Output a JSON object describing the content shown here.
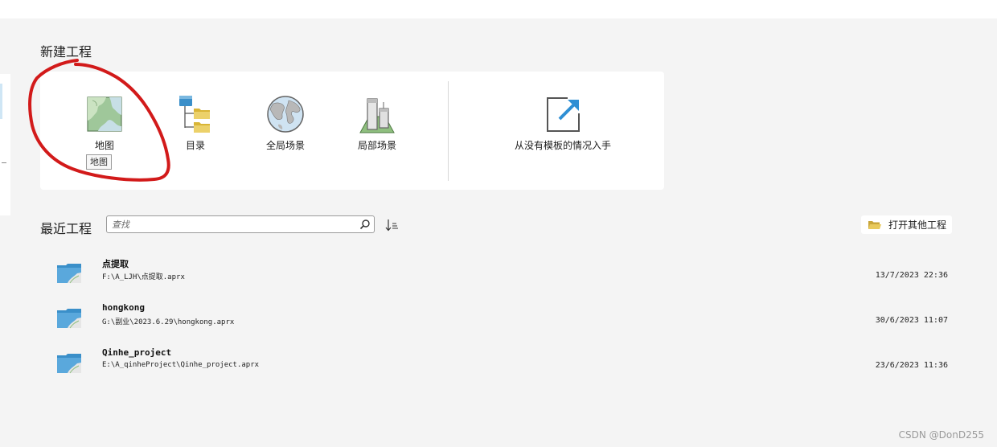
{
  "new_project": {
    "title": "新建工程",
    "templates": [
      {
        "label": "地图",
        "icon": "map-icon"
      },
      {
        "label": "目录",
        "icon": "catalog-icon"
      },
      {
        "label": "全局场景",
        "icon": "globe-icon"
      },
      {
        "label": "局部场景",
        "icon": "local-scene-icon"
      },
      {
        "label": "从没有模板的情况入手",
        "icon": "start-without-template-icon"
      }
    ],
    "tooltip": "地图"
  },
  "recent": {
    "title": "最近工程",
    "search_placeholder": "查找",
    "open_other_label": "打开其他工程",
    "projects": [
      {
        "name": "点提取",
        "path": "F:\\A_LJH\\点提取.aprx",
        "date": "13/7/2023 22:36"
      },
      {
        "name": "hongkong",
        "path": "G:\\副业\\2023.6.29\\hongkong.aprx",
        "date": "30/6/2023 11:07"
      },
      {
        "name": "Qinhe_project",
        "path": "E:\\A_qinheProject\\Qinhe_project.aprx",
        "date": "23/6/2023 11:36"
      }
    ]
  },
  "watermark": "CSDN @DonD255",
  "colors": {
    "background": "#f4f4f4",
    "card": "#ffffff",
    "annotation_red": "#d21a1a",
    "folder_blue": "#3a8fc9",
    "folder_yellow": "#d9b536"
  }
}
